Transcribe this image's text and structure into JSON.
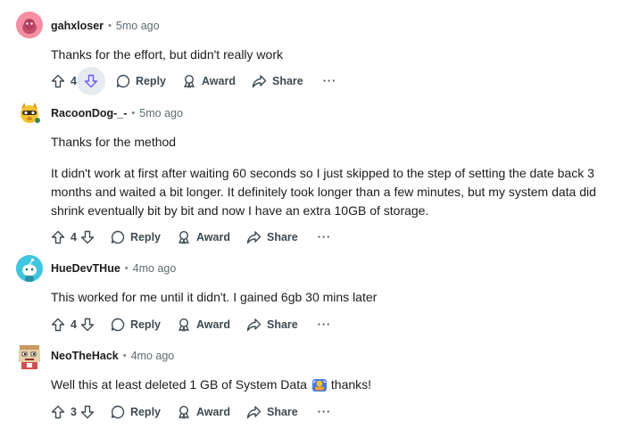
{
  "comments": [
    {
      "username": "gahxloser",
      "age": "5mo ago",
      "paragraphs": [
        "Thanks for the effort, but didn't really work"
      ],
      "votes": "4",
      "reply": "Reply",
      "award": "Award",
      "share": "Share",
      "more": "···",
      "avatar_color": "#f48fa3",
      "downvote_active": true
    },
    {
      "username": "RacoonDog-_-",
      "age": "5mo ago",
      "paragraphs": [
        "Thanks for the method",
        "It didn't work at first after waiting 60 seconds so I just skipped to the step of setting the date back 3 months and waited a bit longer. It definitely took longer than a few minutes, but my system data did shrink eventually bit by bit and now I have an extra 10GB of storage."
      ],
      "votes": "4",
      "reply": "Reply",
      "award": "Award",
      "share": "Share",
      "more": "···",
      "avatar_color": "#f2c232"
    },
    {
      "username": "HueDevTHue",
      "age": "4mo ago",
      "paragraphs": [
        "This worked for me until it didn't. I gained 6gb 30 mins later"
      ],
      "votes": "4",
      "reply": "Reply",
      "award": "Award",
      "share": "Share",
      "more": "···",
      "avatar_color": "#3ec7de"
    },
    {
      "username": "NeoTheHack",
      "age": "4mo ago",
      "paragraphs": [
        "Well this at least deleted 1 GB of System Data",
        "thanks!"
      ],
      "votes": "3",
      "reply": "Reply",
      "award": "Award",
      "share": "Share",
      "more": "···",
      "avatar_color": "#e8d0a8"
    }
  ],
  "separator": "•"
}
